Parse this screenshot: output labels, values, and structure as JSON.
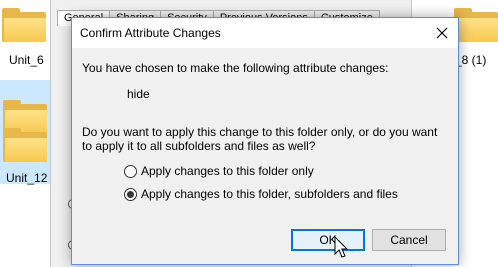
{
  "desktop": {
    "folders": [
      {
        "label": "Unit_6"
      },
      {
        "label": "Unit_12"
      },
      {
        "label": "_8 (1)"
      }
    ]
  },
  "background_dialog": {
    "tabs": [
      "General",
      "Sharing",
      "Security",
      "Previous Versions",
      "Customize"
    ]
  },
  "dialog": {
    "title": "Confirm Attribute Changes",
    "message": "You have chosen to make the following attribute changes:",
    "attribute": "hide",
    "question": "Do you want to apply this change to this folder only, or do you want to apply it to all subfolders and files as well?",
    "options": [
      {
        "label": "Apply changes to this folder only",
        "selected": false
      },
      {
        "label": "Apply changes to this folder, subfolders and files",
        "selected": true
      }
    ],
    "ok_label": "OK",
    "cancel_label": "Cancel",
    "close_icon": "close-icon"
  },
  "colors": {
    "accent": "#0078d7",
    "dialog_border": "#5c8fd6",
    "folder": "#f6c94f"
  }
}
